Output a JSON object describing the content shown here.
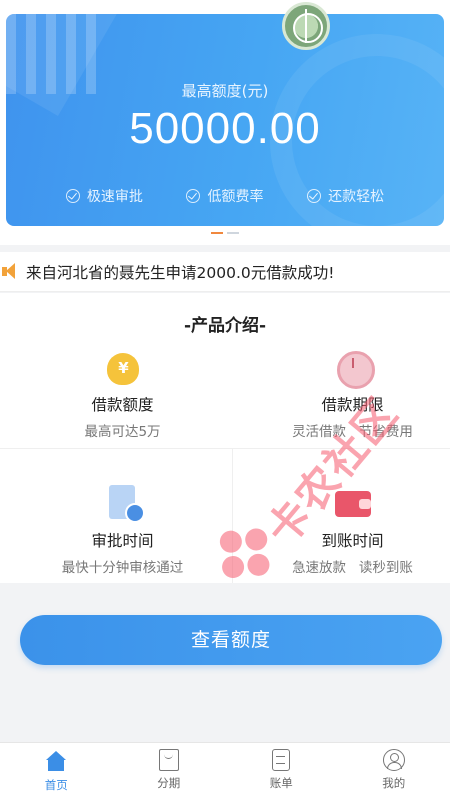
{
  "banner": {
    "subtitle": "最高额度(元)",
    "amount": "50000.00",
    "features": [
      "极速审批",
      "低额费率",
      "还款轻松"
    ],
    "accent": "#3f93ee"
  },
  "notice": {
    "text": "来自河北省的聂先生申请2000.0元借款成功!"
  },
  "products": {
    "title": "-产品介绍-",
    "items": [
      {
        "title": "借款额度",
        "desc": "最高可达5万",
        "icon": "moneybag-icon"
      },
      {
        "title": "借款期限",
        "desc": "灵活借款   节省费用",
        "icon": "alarm-clock-icon"
      },
      {
        "title": "审批时间",
        "desc": "最快十分钟审核通过",
        "icon": "document-check-icon"
      },
      {
        "title": "到账时间",
        "desc": "急速放款   读秒到账",
        "icon": "wallet-icon"
      }
    ]
  },
  "cta": {
    "label": "查看额度"
  },
  "watermark": {
    "text": "卡农社区"
  },
  "tabbar": {
    "items": [
      {
        "label": "首页",
        "icon": "home-icon",
        "active": true
      },
      {
        "label": "分期",
        "icon": "shopping-bag-icon"
      },
      {
        "label": "账单",
        "icon": "bill-icon"
      },
      {
        "label": "我的",
        "icon": "user-icon"
      }
    ]
  }
}
